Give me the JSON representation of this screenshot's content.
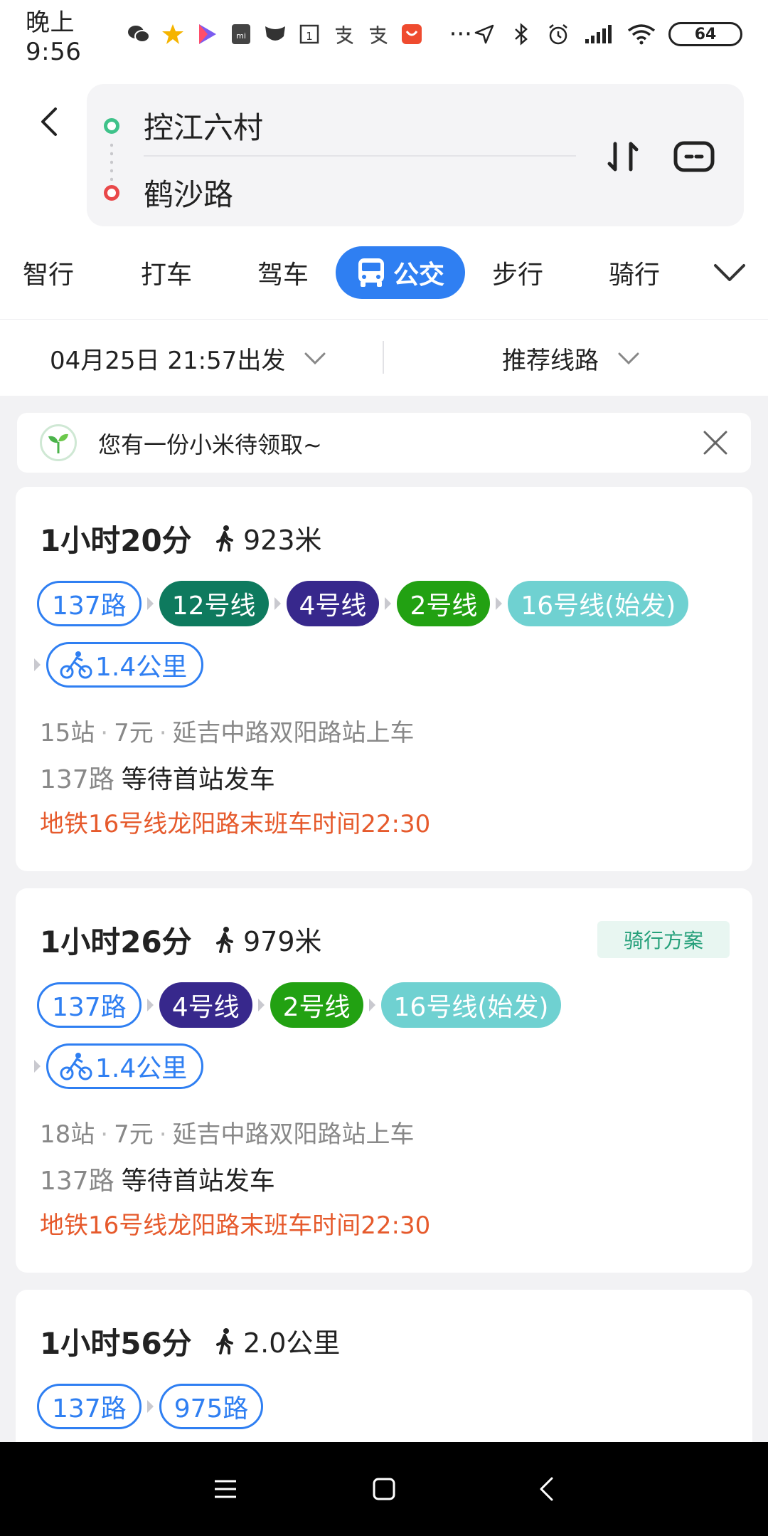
{
  "status_bar": {
    "time": "晚上9:56",
    "battery": "64",
    "overflow": "···"
  },
  "header": {
    "from": "控江六村",
    "to": "鹤沙路"
  },
  "tabs": [
    "智行",
    "打车",
    "驾车",
    "公交",
    "步行",
    "骑行"
  ],
  "active_tab": "公交",
  "filter": {
    "depart": "04月25日 21:57出发",
    "route_pref": "推荐线路"
  },
  "banner": {
    "text": "您有一份小米待领取~"
  },
  "routes": [
    {
      "duration": "1小时20分",
      "walk": "923米",
      "chips": [
        "137路",
        "12号线",
        "4号线",
        "2号线",
        "16号线(始发)"
      ],
      "bike": "1.4公里",
      "stops": "15站",
      "fare": "7元",
      "board": "延吉中路双阳路站上车",
      "wait_line": "137路",
      "wait_text": "等待首站发车",
      "warning": "地铁16号线龙阳路末班车时间22:30"
    },
    {
      "duration": "1小时26分",
      "walk": "979米",
      "badge": "骑行方案",
      "chips": [
        "137路",
        "4号线",
        "2号线",
        "16号线(始发)"
      ],
      "bike": "1.4公里",
      "stops": "18站",
      "fare": "7元",
      "board": "延吉中路双阳路站上车",
      "wait_line": "137路",
      "wait_text": "等待首站发车",
      "warning": "地铁16号线龙阳路末班车时间22:30"
    },
    {
      "duration": "1小时56分",
      "walk": "2.0公里",
      "chips": [
        "137路",
        "975路"
      ]
    }
  ],
  "colors": {
    "accent": "#2f7ff2",
    "line12": "#0e7a5e",
    "line4": "#37288c",
    "line2": "#22a112",
    "line16": "#6fd1d1",
    "warning": "#e65a2c"
  },
  "icons": [
    "wechat-icon",
    "back-icon",
    "swap-icon",
    "options-icon",
    "bus-icon",
    "chevron-down-icon",
    "sprout-icon",
    "close-icon",
    "walk-icon",
    "bike-icon"
  ]
}
